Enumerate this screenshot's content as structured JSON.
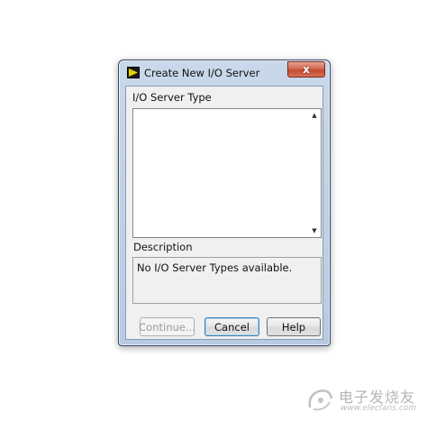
{
  "window": {
    "title": "Create New I/O Server",
    "app_icon": "labview-run-arrow-icon",
    "close_symbol": "x"
  },
  "io_server_type": {
    "label": "I/O Server Type",
    "items": [],
    "scroll_up": "▲",
    "scroll_down": "▼"
  },
  "description": {
    "label": "Description",
    "text": "No I/O Server Types available."
  },
  "buttons": {
    "continue": "Continue...",
    "cancel": "Cancel",
    "help": "Help"
  },
  "watermark": {
    "cn": "电子发烧友",
    "url": "www.elecfans.com"
  },
  "colors": {
    "icon_arrow": "#e8d000",
    "close_button": "#c94a30"
  }
}
